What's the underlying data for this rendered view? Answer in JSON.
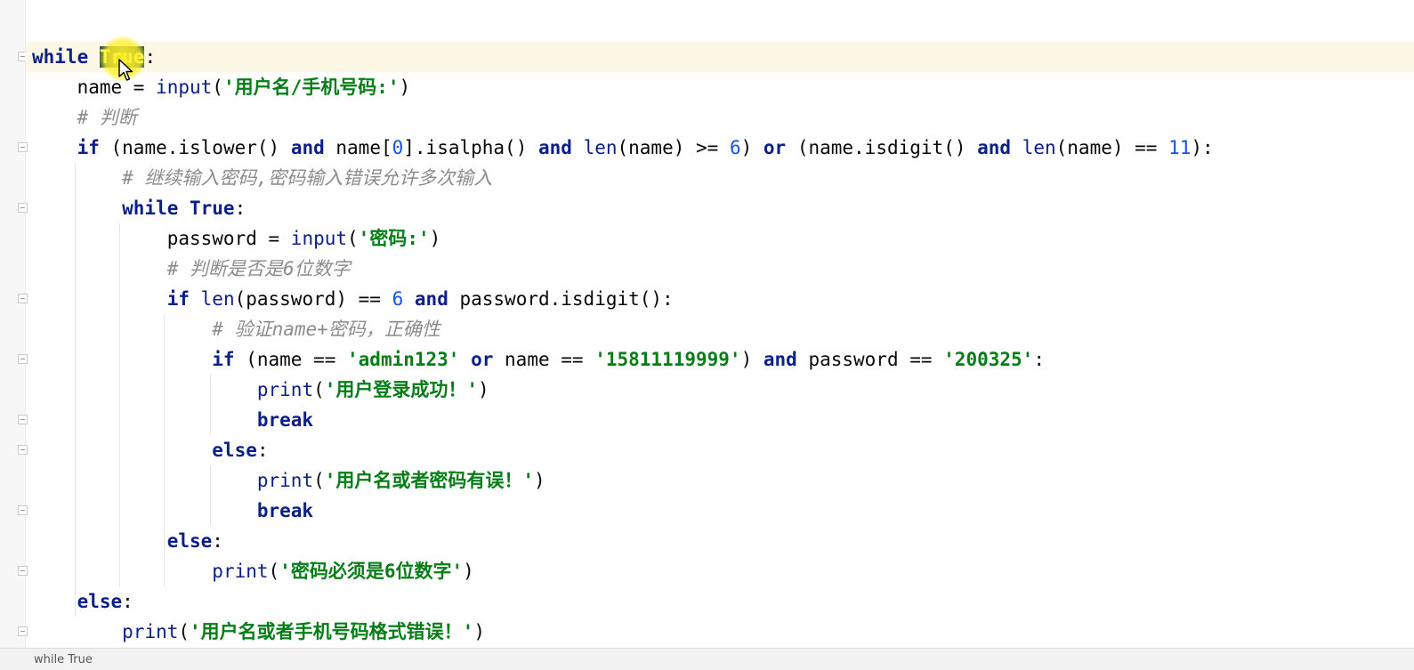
{
  "editor": {
    "lines": [
      [
        {
          "c": "kw",
          "t": "while "
        },
        {
          "c": "true-hl",
          "t": "True"
        },
        {
          "c": "",
          "t": ":"
        }
      ],
      [
        {
          "c": "",
          "t": "    name = "
        },
        {
          "c": "bi",
          "t": "input"
        },
        {
          "c": "",
          "t": "("
        },
        {
          "c": "st",
          "t": "'用户名/手机号码:'"
        },
        {
          "c": "",
          "t": ")"
        }
      ],
      [
        {
          "c": "cm",
          "t": "    # 判断"
        }
      ],
      [
        {
          "c": "kw",
          "t": "    if "
        },
        {
          "c": "",
          "t": "(name.islower() "
        },
        {
          "c": "kw",
          "t": "and "
        },
        {
          "c": "",
          "t": "name["
        },
        {
          "c": "nm",
          "t": "0"
        },
        {
          "c": "",
          "t": "].isalpha() "
        },
        {
          "c": "kw",
          "t": "and "
        },
        {
          "c": "bi",
          "t": "len"
        },
        {
          "c": "",
          "t": "(name) >= "
        },
        {
          "c": "nm",
          "t": "6"
        },
        {
          "c": "",
          "t": ") "
        },
        {
          "c": "kw",
          "t": "or "
        },
        {
          "c": "",
          "t": "(name.isdigit() "
        },
        {
          "c": "kw",
          "t": "and "
        },
        {
          "c": "bi",
          "t": "len"
        },
        {
          "c": "",
          "t": "(name) == "
        },
        {
          "c": "nm",
          "t": "11"
        },
        {
          "c": "",
          "t": "):"
        }
      ],
      [
        {
          "c": "cm",
          "t": "        # 继续输入密码,密码输入错误允许多次输入"
        }
      ],
      [
        {
          "c": "kw",
          "t": "        while True"
        },
        {
          "c": "",
          "t": ":"
        }
      ],
      [
        {
          "c": "",
          "t": "            password = "
        },
        {
          "c": "bi",
          "t": "input"
        },
        {
          "c": "",
          "t": "("
        },
        {
          "c": "st",
          "t": "'密码:'"
        },
        {
          "c": "",
          "t": ")"
        }
      ],
      [
        {
          "c": "cm",
          "t": "            # 判断是否是6位数字"
        }
      ],
      [
        {
          "c": "kw",
          "t": "            if "
        },
        {
          "c": "bi",
          "t": "len"
        },
        {
          "c": "",
          "t": "(password) == "
        },
        {
          "c": "nm",
          "t": "6 "
        },
        {
          "c": "kw",
          "t": "and "
        },
        {
          "c": "",
          "t": "password.isdigit():"
        }
      ],
      [
        {
          "c": "cm",
          "t": "                # 验证name+密码，正确性"
        }
      ],
      [
        {
          "c": "kw",
          "t": "                if "
        },
        {
          "c": "",
          "t": "(name == "
        },
        {
          "c": "st",
          "t": "'admin123' "
        },
        {
          "c": "kw",
          "t": "or "
        },
        {
          "c": "",
          "t": "name == "
        },
        {
          "c": "st",
          "t": "'15811119999'"
        },
        {
          "c": "",
          "t": ") "
        },
        {
          "c": "kw",
          "t": "and "
        },
        {
          "c": "",
          "t": "password == "
        },
        {
          "c": "st",
          "t": "'200325'"
        },
        {
          "c": "",
          "t": ":"
        }
      ],
      [
        {
          "c": "",
          "t": "                    "
        },
        {
          "c": "bi",
          "t": "print"
        },
        {
          "c": "",
          "t": "("
        },
        {
          "c": "st",
          "t": "'用户登录成功！'"
        },
        {
          "c": "",
          "t": ")"
        }
      ],
      [
        {
          "c": "kw",
          "t": "                    break"
        }
      ],
      [
        {
          "c": "kw",
          "t": "                else"
        },
        {
          "c": "",
          "t": ":"
        }
      ],
      [
        {
          "c": "",
          "t": "                    "
        },
        {
          "c": "bi",
          "t": "print"
        },
        {
          "c": "",
          "t": "("
        },
        {
          "c": "st",
          "t": "'用户名或者密码有误！'"
        },
        {
          "c": "",
          "t": ")"
        }
      ],
      [
        {
          "c": "kw",
          "t": "                    break"
        }
      ],
      [
        {
          "c": "kw",
          "t": "            else"
        },
        {
          "c": "",
          "t": ":"
        }
      ],
      [
        {
          "c": "",
          "t": "                "
        },
        {
          "c": "bi",
          "t": "print"
        },
        {
          "c": "",
          "t": "("
        },
        {
          "c": "st",
          "t": "'密码必须是6位数字'"
        },
        {
          "c": "",
          "t": ")"
        }
      ],
      [
        {
          "c": "kw",
          "t": "    else"
        },
        {
          "c": "",
          "t": ":"
        }
      ],
      [
        {
          "c": "",
          "t": "        "
        },
        {
          "c": "bi",
          "t": "print"
        },
        {
          "c": "",
          "t": "("
        },
        {
          "c": "st",
          "t": "'用户名或者手机号码格式错误！'"
        },
        {
          "c": "",
          "t": ")"
        }
      ]
    ]
  },
  "status_bar": {
    "breadcrumb": "while True"
  },
  "colors": {
    "keyword": "#0b1f8a",
    "string": "#067d17",
    "number": "#1750eb",
    "comment": "#8c8c8c",
    "current_line": "#fdf8e6",
    "cursor_highlight": "#fff028"
  },
  "icons": [
    "fold-marker-icon",
    "mouse-pointer-icon"
  ]
}
